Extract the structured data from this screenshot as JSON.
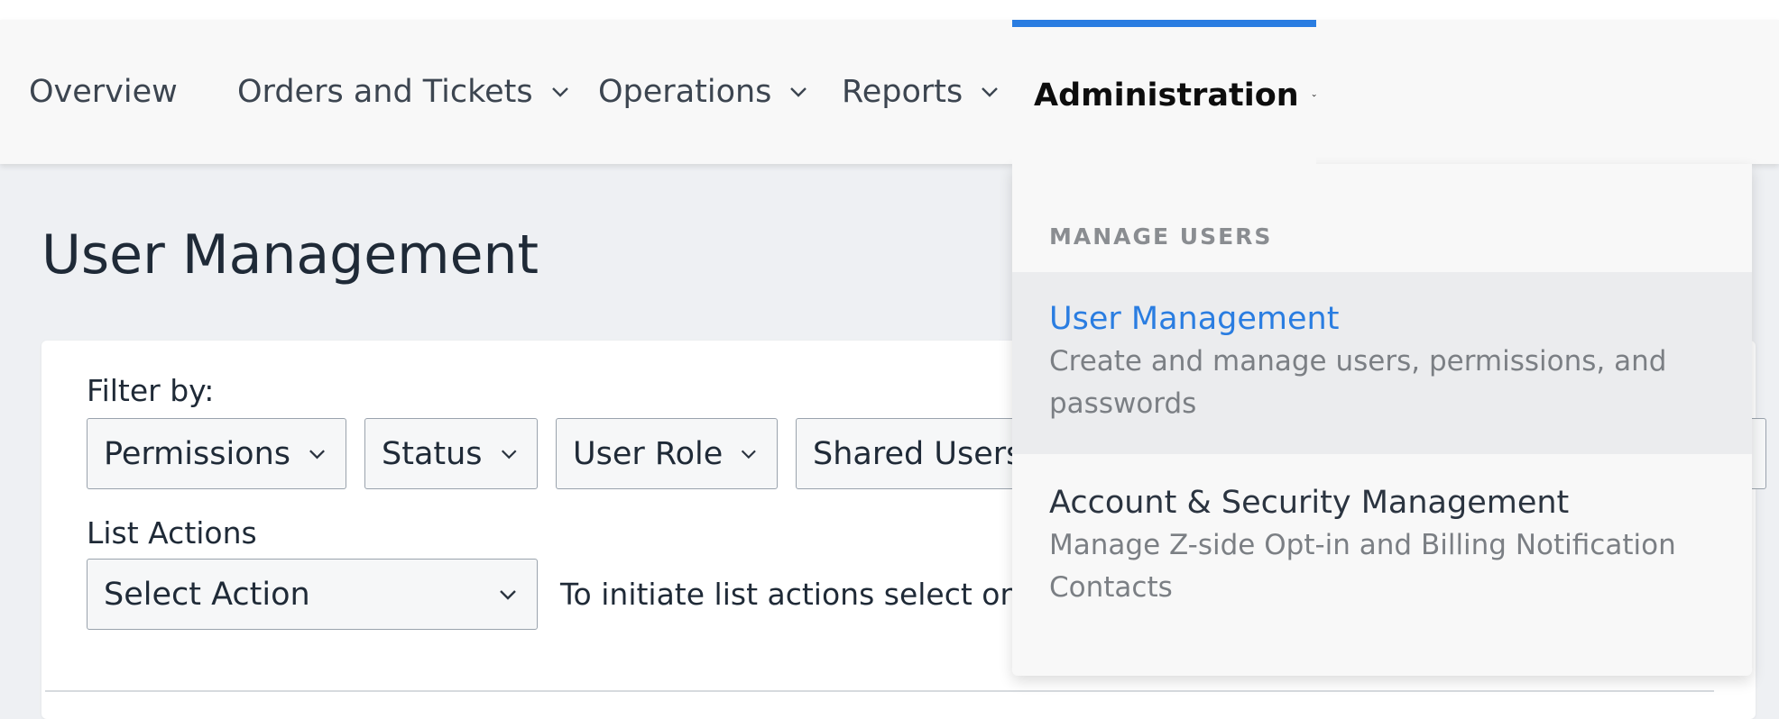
{
  "nav": {
    "items": [
      {
        "label": "Overview"
      },
      {
        "label": "Orders and Tickets"
      },
      {
        "label": "Operations"
      },
      {
        "label": "Reports"
      },
      {
        "label": "Administration"
      }
    ]
  },
  "page": {
    "title": "User Management"
  },
  "filter": {
    "label": "Filter by:",
    "options": [
      {
        "label": "Permissions"
      },
      {
        "label": "Status"
      },
      {
        "label": "User Role"
      },
      {
        "label": "Shared Users"
      }
    ]
  },
  "list_actions": {
    "label": "List Actions",
    "select_value": "Select Action",
    "hint": "To initiate list actions select on"
  },
  "dropdown": {
    "section_label": "MANAGE USERS",
    "items": [
      {
        "title": "User Management",
        "description": "Create and manage users, permissions, and passwords"
      },
      {
        "title": "Account & Security Management",
        "description": "Manage Z-side Opt-in and Billing Notification Contacts"
      }
    ]
  },
  "colors": {
    "accent": "#2a7de1",
    "link": "#2a7de1"
  }
}
